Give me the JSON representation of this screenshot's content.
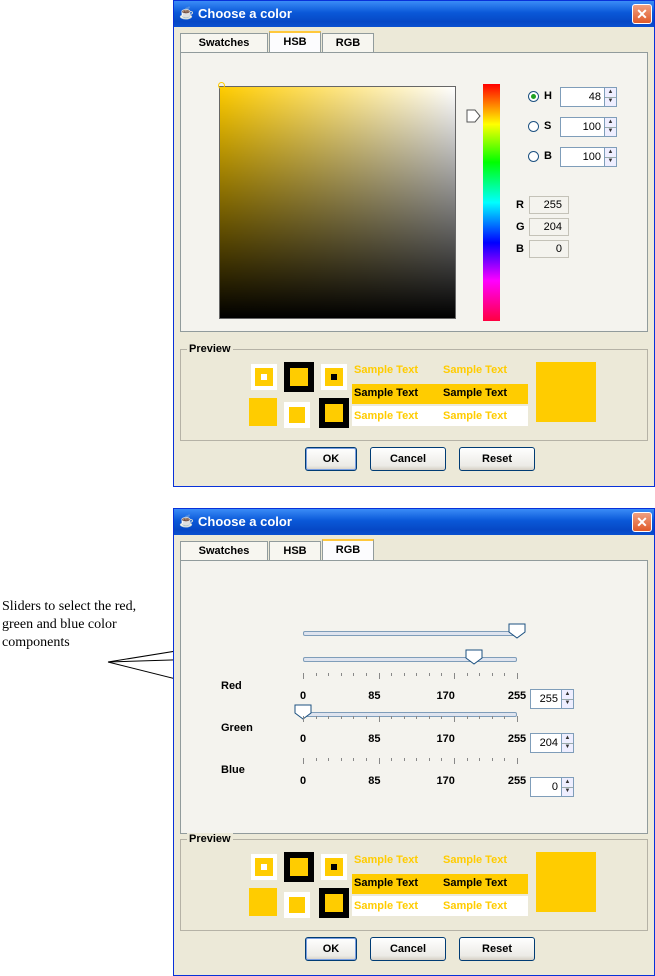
{
  "window_title": "Choose a color",
  "tabs": [
    "Swatches",
    "HSB",
    "RGB"
  ],
  "hsb_panel": {
    "h_label": "H",
    "s_label": "S",
    "b_label": "B",
    "h_value": "48",
    "s_value": "100",
    "b_value": "100",
    "selected_mode": "H",
    "r_label": "R",
    "g_label": "G",
    "b2_label": "B",
    "r_value": "255",
    "g_value": "204",
    "b2_value": "0"
  },
  "rgb_panel": {
    "red_label": "Red",
    "green_label": "Green",
    "blue_label": "Blue",
    "red_value": "255",
    "green_value": "204",
    "blue_value": "0",
    "tick_labels": [
      "0",
      "85",
      "170",
      "255"
    ],
    "slider_max": 255,
    "red_level": 255,
    "green_level": 204,
    "blue_level": 0
  },
  "preview": {
    "label": "Preview",
    "sample_text": "Sample Text"
  },
  "buttons": {
    "ok": "OK",
    "cancel": "Cancel",
    "reset": "Reset"
  },
  "annotation": "Sliders to select the red, green and blue color components",
  "colors": {
    "selected": "#ffcc00",
    "title_bar": "#0a58d8",
    "dialog_bg": "#ece9d8"
  }
}
